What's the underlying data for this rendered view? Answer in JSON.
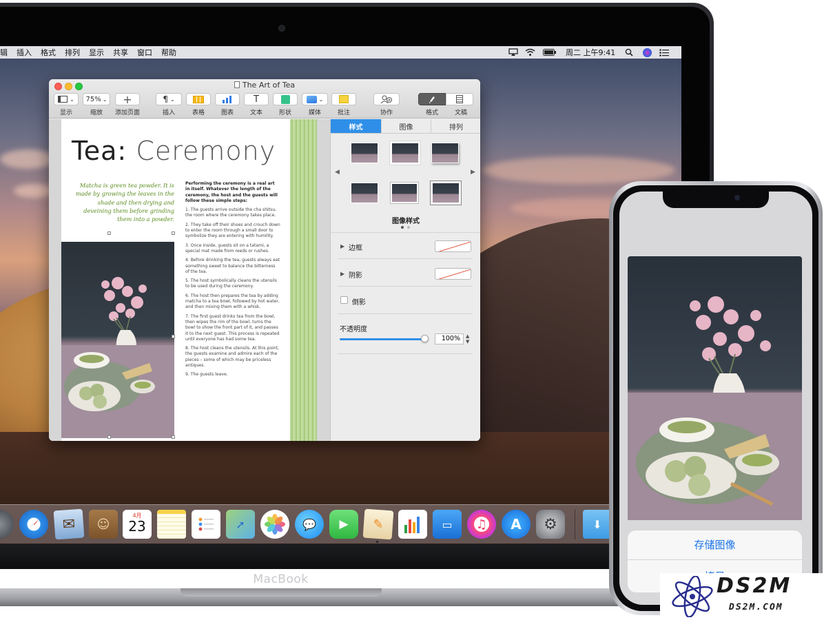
{
  "menubar": {
    "items": [
      "辑",
      "插入",
      "格式",
      "排列",
      "显示",
      "共享",
      "窗口",
      "帮助"
    ],
    "clock": "周二 上午9:41"
  },
  "window": {
    "title": "The Art of Tea",
    "toolbar": {
      "view": "显示",
      "zoom_value": "75%",
      "zoom": "缩放",
      "add_page": "添加页面",
      "insert": "插入",
      "table": "表格",
      "chart": "图表",
      "text": "文本",
      "shape": "形状",
      "media": "媒体",
      "comment": "批注",
      "collaborate": "协作",
      "format": "格式",
      "document": "文稿"
    }
  },
  "document": {
    "title_bold": "Tea:",
    "title_light": "Ceremony",
    "quote": "Matcha is green tea powder. It is made by growing the leaves in the shade and then drying and deveining them before grinding them into a powder.",
    "lead": "Performing the ceremony is a real art in itself. Whatever the length of the ceremony, the host and the guests will follow these simple steps:",
    "steps": [
      "1. The guests arrive outside the cha shitsu, the room where the ceremony takes place.",
      "2. They take off their shoes and crouch down to enter the room through a small door to symbolize they are entering with humility.",
      "3. Once inside, guests sit on a tatami, a special mat made from reeds or rushes.",
      "4. Before drinking the tea, guests always eat something sweet to balance the bitterness of the tea.",
      "5. The host symbolically cleans the utensils to be used during the ceremony.",
      "6. The host then prepares the tea by adding matcha to a tea bowl, followed by hot water, and then mixing them with a whisk.",
      "7. The first guest drinks tea from the bowl, then wipes the rim of the bowl, turns the bowl to show the front part of it, and passes it to the next guest. This process is repeated until everyone has had some tea.",
      "8. The host cleans the utensils. At this point, the guests examine and admire each of the pieces – some of which may be priceless antiques.",
      "9. The guests leave."
    ]
  },
  "inspector": {
    "tabs": [
      "样式",
      "图像",
      "排列"
    ],
    "styles_label": "图像样式",
    "border": "边框",
    "shadow": "阴影",
    "reflection": "倒影",
    "opacity": "不透明度",
    "opacity_value": "100%",
    "opacity_fraction": 1.0
  },
  "macbook": {
    "label": "MacBook"
  },
  "dock": {
    "calendar_month": "4月",
    "calendar_day": "23",
    "icons": [
      "launchpad-icon",
      "safari-icon",
      "mail-icon",
      "contacts-icon",
      "calendar-icon",
      "notes-icon",
      "reminders-icon",
      "maps-icon",
      "photos-icon",
      "messages-icon",
      "facetime-icon",
      "pages-icon",
      "numbers-icon",
      "keynote-icon",
      "itunes-icon",
      "app-store-icon",
      "system-preferences-icon",
      "downloads-folder-icon"
    ]
  },
  "iphone": {
    "save_image": "存储图像",
    "second_option": "拷贝"
  },
  "watermark": {
    "main": "DS2M",
    "sub": "DS2M.COM"
  },
  "colors": {
    "accent": "#1a75e8",
    "quote_green": "#5a8c1e",
    "tab_active": "#2f8fe8"
  }
}
